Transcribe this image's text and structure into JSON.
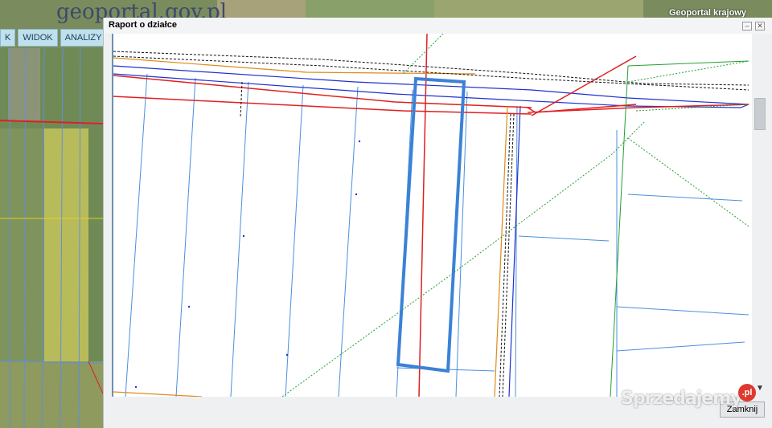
{
  "header": {
    "logo_text": "geoportal.gov.pl",
    "right_title": "Geoportal krajowy"
  },
  "menu": {
    "items": [
      {
        "label": "K"
      },
      {
        "label": "WIDOK"
      },
      {
        "label": "ANALIZY"
      }
    ]
  },
  "dialog": {
    "title": "Raport o działce",
    "minimize_icon": "minimize-icon",
    "close_icon": "close-icon",
    "close_button_label": "Zamknij"
  },
  "map": {
    "parcel_outline_color": "#3b82d6",
    "colors": {
      "red": "#e02020",
      "blue": "#2030d0",
      "light_blue": "#4a8fe0",
      "green": "#22a032",
      "orange": "#e08a1a",
      "black": "#111111"
    }
  },
  "watermark": {
    "text": "Sprzedajemy",
    "badge": ".pl"
  }
}
